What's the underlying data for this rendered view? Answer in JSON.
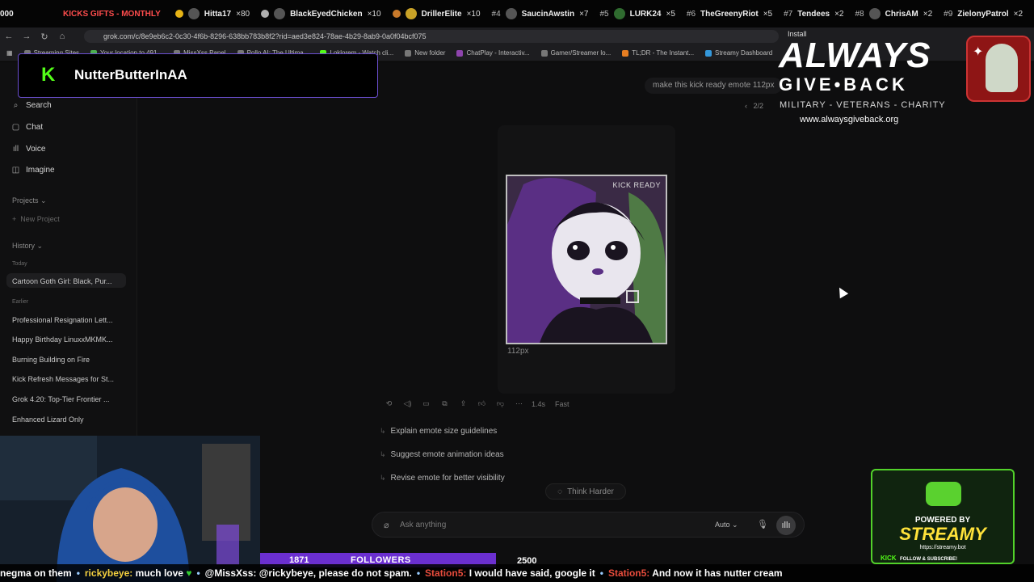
{
  "leaderboard": {
    "left_partial": "000",
    "title": "KICKS GIFTS - MONTHLY",
    "entries": [
      {
        "rank": "",
        "name": "Hitta17",
        "count": "×80"
      },
      {
        "rank": "",
        "name": "BlackEyedChicken",
        "count": "×10"
      },
      {
        "rank": "",
        "name": "DrillerElite",
        "count": "×10"
      },
      {
        "rank": "#4",
        "name": "SaucinAwstin",
        "count": "×7"
      },
      {
        "rank": "#5",
        "name": "LURK24",
        "count": "×5"
      },
      {
        "rank": "#6",
        "name": "TheGreenyRiot",
        "count": "×5"
      },
      {
        "rank": "#7",
        "name": "Tendees",
        "count": "×2"
      },
      {
        "rank": "#8",
        "name": "ChrisAM",
        "count": "×2"
      },
      {
        "rank": "#9",
        "name": "ZielonyPatrol",
        "count": "×2"
      }
    ]
  },
  "browser": {
    "url": "grok.com/c/8e9eb6c2-0c30-4f6b-8296-638bb783b8f2?rid=aed3e824-78ae-4b29-8ab9-0a0f04bcf075",
    "install_label": "Install",
    "bookmarks": [
      "Streaming Sites",
      "Your location to 491...",
      "MissXss Panel",
      "Pollo AI: The Ultima...",
      "Loklorem - Watch cli...",
      "New folder",
      "ChatPlay - Interactiv...",
      "Gamer/Streamer lo...",
      "TL;DR - The Instant...",
      "Streamy Dashboard"
    ]
  },
  "sidebar": {
    "nav": [
      {
        "label": "Search",
        "icon": "search-icon"
      },
      {
        "label": "Chat",
        "icon": "chat-icon"
      },
      {
        "label": "Voice",
        "icon": "voice-icon"
      },
      {
        "label": "Imagine",
        "icon": "image-icon"
      }
    ],
    "projects_label": "Projects",
    "new_project_label": "New Project",
    "history_label": "History",
    "today_label": "Today",
    "earlier_label": "Earlier",
    "today_items": [
      "Cartoon Goth Girl: Black, Pur..."
    ],
    "earlier_items": [
      "Professional Resignation Lett...",
      "Happy Birthday LinuxxMKMK...",
      "Burning Building on Fire",
      "Kick Refresh Messages for St...",
      "Grok 4.20: Top-Tier Frontier ...",
      "Enhanced Lizard Only"
    ]
  },
  "namecard": {
    "name": "NutterButterInAA"
  },
  "chat": {
    "user_message": "make this kick ready emote 112px",
    "pager": "2/2",
    "emote_badge": "KICK READY",
    "emote_caption": "112px",
    "response_time": "1.4s",
    "response_mode": "Fast",
    "suggestions": [
      "Explain emote size guidelines",
      "Suggest emote animation ideas",
      "Revise emote for better visibility"
    ],
    "think_harder_label": "Think Harder",
    "composer_placeholder": "Ask anything",
    "model_label": "Auto"
  },
  "overlay_logo": {
    "line1": "ALWAYS",
    "line2": "GIVE•BACK",
    "line3": "MILITARY - VETERANS - CHARITY",
    "line4": "www.alwaysgiveback.org"
  },
  "streamy": {
    "powered_by": "POWERED BY",
    "name": "STREAMY",
    "url": "https://streamy.bot",
    "kick_label": "KICK",
    "follow_label": "FOLLOW & SUBSCRIBE!"
  },
  "followers_goal": {
    "current": "1871",
    "label": "FOLLOWERS",
    "target": "2500"
  },
  "ticker": [
    {
      "user": "",
      "text": "negma on them",
      "color": "white"
    },
    {
      "user": "rickybeye:",
      "text": "much love",
      "color": "yellow"
    },
    {
      "user": "@MissXss:",
      "text": "@rickybeye, please do not spam.",
      "color": "white"
    },
    {
      "user": "Station5:",
      "text": "I would have said, google it",
      "color": "red"
    },
    {
      "user": "Station5:",
      "text": "And now it has nutter cream",
      "color": "red"
    }
  ],
  "accent_colors": {
    "kick_green": "#53fc18",
    "namecard_border": "#6b4fd0",
    "followers_bar": "#6b2fd0"
  }
}
